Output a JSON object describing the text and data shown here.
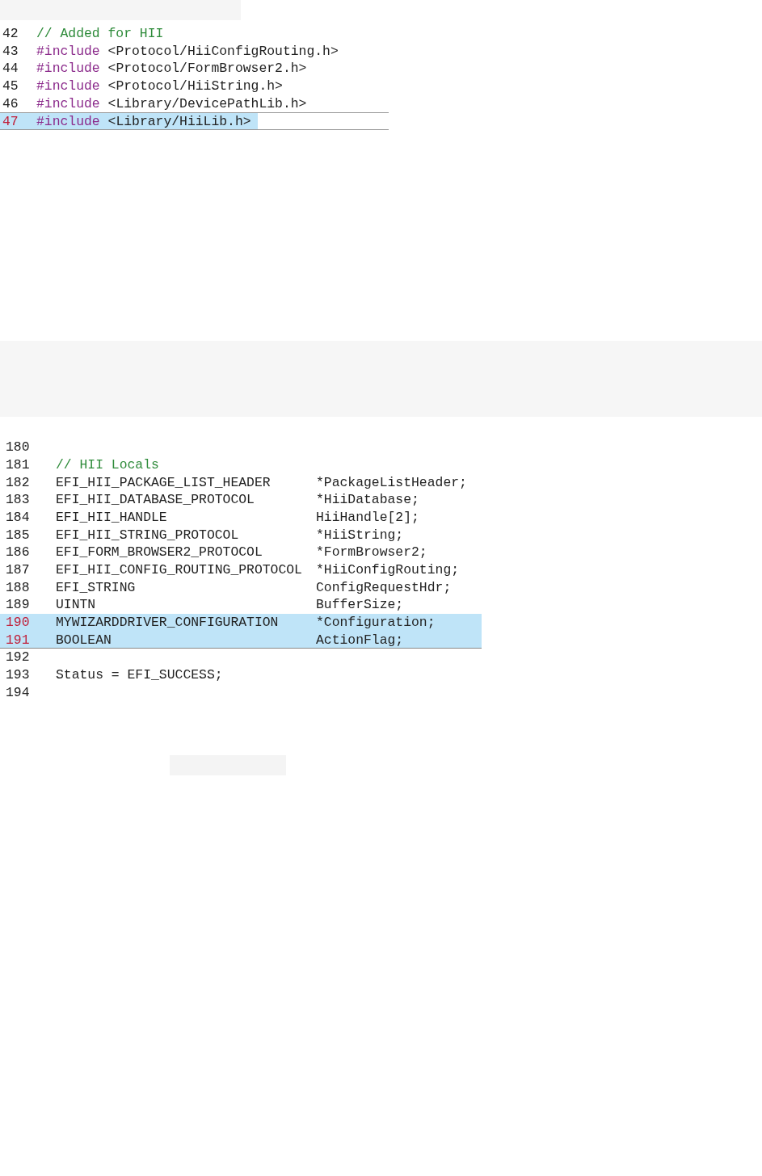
{
  "snippets": [
    {
      "kind": "includes",
      "lines": [
        {
          "number": "42",
          "highlighted": false,
          "parts": [
            {
              "kind": "comment",
              "text": "// Added for HII"
            }
          ]
        },
        {
          "number": "43",
          "highlighted": false,
          "parts": [
            {
              "kind": "directive",
              "text": "#include"
            },
            {
              "kind": "plain",
              "text": "<Protocol/HiiConfigRouting.h>"
            }
          ]
        },
        {
          "number": "44",
          "highlighted": false,
          "parts": [
            {
              "kind": "directive",
              "text": "#include"
            },
            {
              "kind": "plain",
              "text": "<Protocol/FormBrowser2.h>"
            }
          ]
        },
        {
          "number": "45",
          "highlighted": false,
          "parts": [
            {
              "kind": "directive",
              "text": "#include"
            },
            {
              "kind": "plain",
              "text": "<Protocol/HiiString.h>"
            }
          ]
        },
        {
          "number": "46",
          "highlighted": false,
          "parts": [
            {
              "kind": "directive",
              "text": "#include"
            },
            {
              "kind": "plain",
              "text": "<Library/DevicePathLib.h>"
            }
          ]
        },
        {
          "number": "47",
          "highlighted": true,
          "parts": [
            {
              "kind": "directive",
              "text": "#include"
            },
            {
              "kind": "plain",
              "text": "<Library/HiiLib.h>"
            }
          ]
        }
      ]
    },
    {
      "kind": "locals",
      "lines": [
        {
          "number": "180",
          "highlighted": false
        },
        {
          "number": "181",
          "highlighted": false,
          "parts": [
            {
              "kind": "comment",
              "text": "// HII Locals"
            }
          ]
        },
        {
          "number": "182",
          "highlighted": false,
          "parts": [
            {
              "kind": "type",
              "text": "EFI_HII_PACKAGE_LIST_HEADER"
            },
            {
              "kind": "name",
              "text": "*PackageListHeader;"
            }
          ]
        },
        {
          "number": "183",
          "highlighted": false,
          "parts": [
            {
              "kind": "type",
              "text": "EFI_HII_DATABASE_PROTOCOL"
            },
            {
              "kind": "name",
              "text": "*HiiDatabase;"
            }
          ]
        },
        {
          "number": "184",
          "highlighted": false,
          "parts": [
            {
              "kind": "type",
              "text": "EFI_HII_HANDLE"
            },
            {
              "kind": "name",
              "text": "HiiHandle[2];"
            }
          ]
        },
        {
          "number": "185",
          "highlighted": false,
          "parts": [
            {
              "kind": "type",
              "text": "EFI_HII_STRING_PROTOCOL"
            },
            {
              "kind": "name",
              "text": "*HiiString;"
            }
          ]
        },
        {
          "number": "186",
          "highlighted": false,
          "parts": [
            {
              "kind": "type",
              "text": "EFI_FORM_BROWSER2_PROTOCOL"
            },
            {
              "kind": "name",
              "text": "*FormBrowser2;"
            }
          ]
        },
        {
          "number": "187",
          "highlighted": false,
          "parts": [
            {
              "kind": "type",
              "text": "EFI_HII_CONFIG_ROUTING_PROTOCOL"
            },
            {
              "kind": "name",
              "text": "*HiiConfigRouting;"
            }
          ]
        },
        {
          "number": "188",
          "highlighted": false,
          "parts": [
            {
              "kind": "type",
              "text": "EFI_STRING"
            },
            {
              "kind": "name",
              "text": "ConfigRequestHdr;"
            }
          ]
        },
        {
          "number": "189",
          "highlighted": false,
          "parts": [
            {
              "kind": "type",
              "text": "UINTN"
            },
            {
              "kind": "name",
              "text": "BufferSize;"
            }
          ]
        },
        {
          "number": "190",
          "highlighted": true,
          "parts": [
            {
              "kind": "type",
              "text": "MYWIZARDDRIVER_CONFIGURATION"
            },
            {
              "kind": "name",
              "text": "*Configuration;"
            }
          ]
        },
        {
          "number": "191",
          "highlighted": true,
          "parts": [
            {
              "kind": "type",
              "text": "BOOLEAN"
            },
            {
              "kind": "name",
              "text": "ActionFlag;"
            }
          ]
        },
        {
          "number": "192",
          "highlighted": false
        },
        {
          "number": "193",
          "highlighted": false,
          "parts": [
            {
              "kind": "plain",
              "text": "Status = EFI_SUCCESS;"
            }
          ]
        },
        {
          "number": "194",
          "highlighted": false
        }
      ]
    }
  ]
}
